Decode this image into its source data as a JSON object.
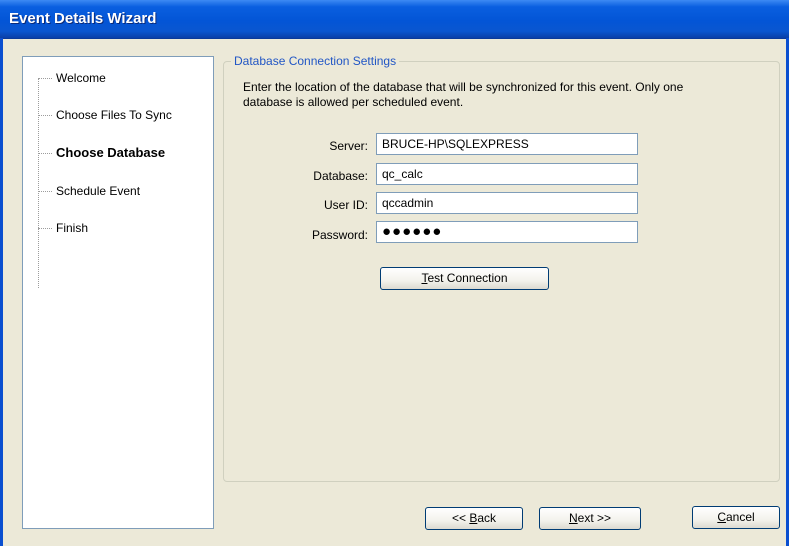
{
  "window": {
    "title": "Event Details Wizard"
  },
  "nav": {
    "items": [
      {
        "label": "Welcome"
      },
      {
        "label": "Choose Files To Sync"
      },
      {
        "label": "Choose Database"
      },
      {
        "label": "Schedule Event"
      },
      {
        "label": "Finish"
      }
    ],
    "active_index": 2
  },
  "settings": {
    "title": "Database Connection Settings",
    "description_line1": "Enter the location of the database that will be synchronized for this event. Only one",
    "description_line2": "database is allowed per scheduled event.",
    "fields": {
      "server": {
        "label": "Server:",
        "value": "BRUCE-HP\\SQLEXPRESS"
      },
      "database": {
        "label": "Database:",
        "value": "qc_calc"
      },
      "user_id": {
        "label": "User ID:",
        "value": "qccadmin"
      },
      "password": {
        "label": "Password:",
        "value": "●●●●●●"
      }
    },
    "test_button": {
      "mnemonic": "T",
      "rest": "est Connection"
    }
  },
  "footer": {
    "back_button": {
      "prefix": "<< ",
      "mnemonic": "B",
      "rest": "ack"
    },
    "next_button": {
      "mnemonic": "N",
      "rest": "ext >>"
    },
    "cancel_button": {
      "mnemonic": "C",
      "rest": "ancel"
    }
  },
  "colors": {
    "titlebar": "#0355d6",
    "group_title": "#2156c5",
    "dialog_bg": "#ece9d8"
  }
}
